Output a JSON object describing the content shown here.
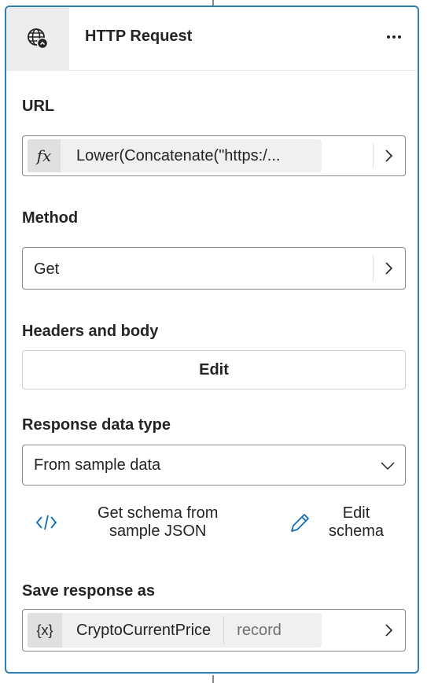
{
  "header": {
    "title": "HTTP Request",
    "node_icon": "globe-icon",
    "more_icon": "more-horizontal-icon"
  },
  "url": {
    "label": "URL",
    "fx_symbol": "fx",
    "value": "Lower(Concatenate(\"https:/..."
  },
  "method": {
    "label": "Method",
    "value": "Get"
  },
  "headers_body": {
    "label": "Headers and body",
    "button": "Edit"
  },
  "response_type": {
    "label": "Response data type",
    "value": "From sample data"
  },
  "actions": {
    "get_schema_line1": "Get schema from",
    "get_schema_line2": "sample JSON",
    "edit_schema_line1": "Edit",
    "edit_schema_line2": "schema"
  },
  "save_response": {
    "label": "Save response as",
    "var_symbol": "{x}",
    "variable": "CryptoCurrentPrice",
    "type": "record"
  },
  "colors": {
    "accent": "#2f7fb5",
    "link_icon": "#0f6cbd"
  }
}
